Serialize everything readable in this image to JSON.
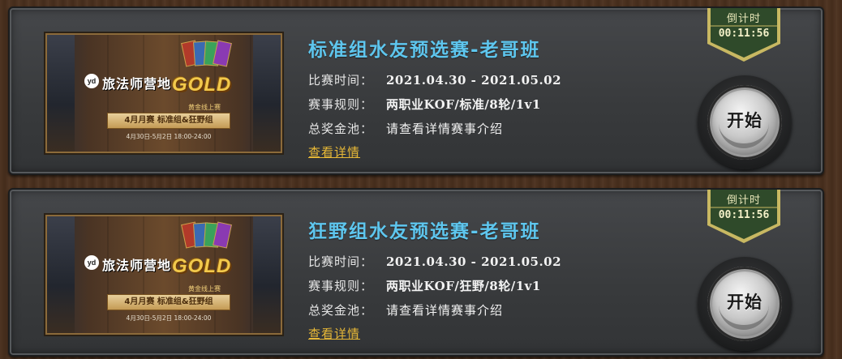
{
  "colors": {
    "title": "#5ec6ee",
    "link": "#e7b837",
    "timer_bg": "#2f4a2a",
    "timer_border": "#c8b862"
  },
  "tournaments": [
    {
      "title": "标准组水友预选赛-老哥班",
      "time_label": "比赛时间：",
      "time_value": "2021.04.30 - 2021.05.02",
      "rules_label": "赛事规则：",
      "rules_value": "两职业KOF/标准/8轮/1v1",
      "prize_label": "总奖金池：",
      "prize_value": "请查看详情赛事介绍",
      "details_link": "查看详情",
      "countdown_label": "倒计时",
      "countdown_value": "00:11:56",
      "start_button": "开始",
      "thumbnail": {
        "logo": "yd",
        "brand": "旅法师营地",
        "gold": "GOLD",
        "gold_sub": "黄金线上赛",
        "banner": "4月月赛 标准组&狂野组",
        "date": "4月30日-5月2日 18:00-24:00"
      }
    },
    {
      "title": "狂野组水友预选赛-老哥班",
      "time_label": "比赛时间：",
      "time_value": "2021.04.30 - 2021.05.02",
      "rules_label": "赛事规则：",
      "rules_value": "两职业KOF/狂野/8轮/1v1",
      "prize_label": "总奖金池：",
      "prize_value": "请查看详情赛事介绍",
      "details_link": "查看详情",
      "countdown_label": "倒计时",
      "countdown_value": "00:11:56",
      "start_button": "开始",
      "thumbnail": {
        "logo": "yd",
        "brand": "旅法师营地",
        "gold": "GOLD",
        "gold_sub": "黄金线上赛",
        "banner": "4月月赛 标准组&狂野组",
        "date": "4月30日-5月2日 18:00-24:00"
      }
    }
  ]
}
